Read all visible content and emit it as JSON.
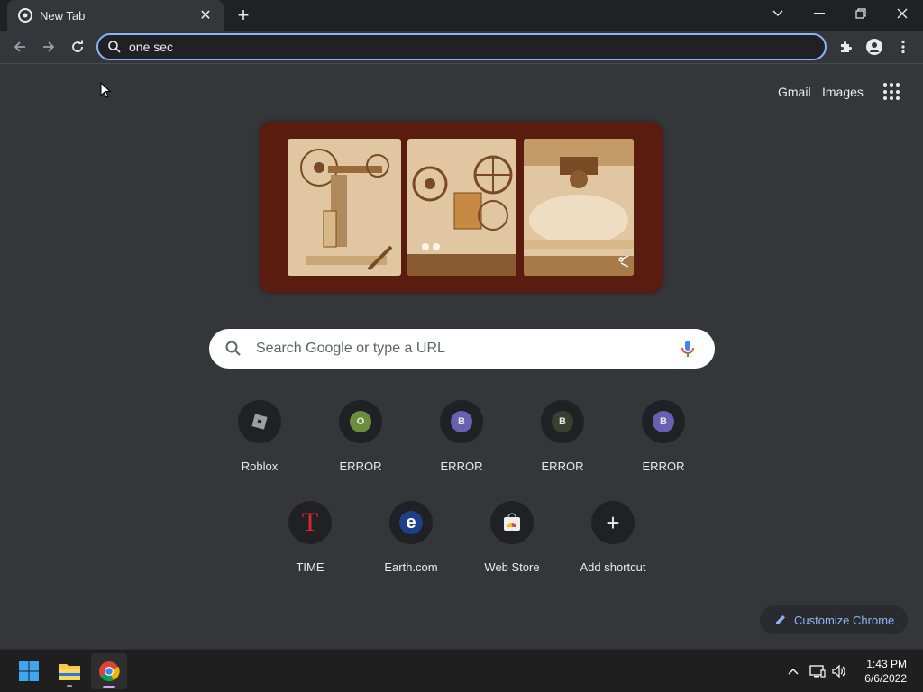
{
  "tab": {
    "title": "New Tab"
  },
  "omnibox": {
    "value": "one sec"
  },
  "top_links": {
    "gmail": "Gmail",
    "images": "Images"
  },
  "search": {
    "placeholder": "Search Google or type a URL"
  },
  "shortcuts_row1": [
    {
      "label": "Roblox"
    },
    {
      "label": "ERROR",
      "letter": "O",
      "color": "#6b8e3e"
    },
    {
      "label": "ERROR",
      "letter": "B",
      "color": "#6a5fb0"
    },
    {
      "label": "ERROR",
      "letter": "B",
      "color": "#3a3f30"
    },
    {
      "label": "ERROR",
      "letter": "B",
      "color": "#6a5fb0"
    }
  ],
  "shortcuts_row2": [
    {
      "label": "TIME",
      "letter": "T"
    },
    {
      "label": "Earth.com",
      "letter": "e"
    },
    {
      "label": "Web Store"
    },
    {
      "label": "Add shortcut",
      "letter": "+"
    }
  ],
  "customize": {
    "label": "Customize Chrome"
  },
  "taskbar": {
    "time": "1:43 PM",
    "date": "6/6/2022"
  },
  "colors": {
    "accent": "#8ab4f8",
    "background": "#35363a",
    "toolbar": "#202124"
  }
}
